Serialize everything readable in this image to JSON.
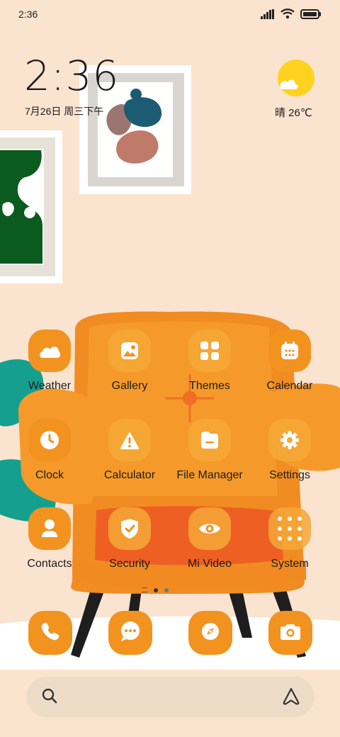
{
  "status_bar": {
    "time": "2:36",
    "icons": [
      "signal-icon",
      "wifi-icon",
      "battery-icon"
    ]
  },
  "clock_widget": {
    "time": "2:36",
    "date": "7月26日 周三下午"
  },
  "weather_widget": {
    "text": "晴 26℃",
    "icon": "sun-cloud-icon"
  },
  "apps": [
    {
      "label": "Weather",
      "icon": "weather-cloud-icon"
    },
    {
      "label": "Gallery",
      "icon": "gallery-icon"
    },
    {
      "label": "Themes",
      "icon": "themes-grid-icon"
    },
    {
      "label": "Calendar",
      "icon": "calendar-icon"
    },
    {
      "label": "Clock",
      "icon": "clock-icon"
    },
    {
      "label": "Calculator",
      "icon": "warning-triangle-icon"
    },
    {
      "label": "File Manager",
      "icon": "folder-icon"
    },
    {
      "label": "Settings",
      "icon": "gear-icon"
    },
    {
      "label": "Contacts",
      "icon": "person-icon"
    },
    {
      "label": "Security",
      "icon": "shield-check-icon"
    },
    {
      "label": "Mi Video",
      "icon": "eye-play-icon"
    },
    {
      "label": "System",
      "icon": "folder-grid-icon"
    }
  ],
  "page_indicator": {
    "pages": 2,
    "current": 1
  },
  "dock": [
    {
      "icon": "phone-icon"
    },
    {
      "icon": "message-icon"
    },
    {
      "icon": "browser-compass-icon"
    },
    {
      "icon": "camera-icon"
    }
  ],
  "search": {
    "left_icon": "search-icon",
    "right_icon": "assistant-icon"
  },
  "colors": {
    "wallpaper": "#fae3cf",
    "app_tile": "#f29320",
    "sun": "#ffd21f"
  }
}
